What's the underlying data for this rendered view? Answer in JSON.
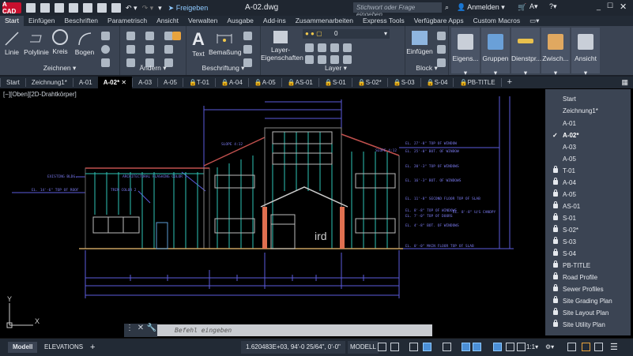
{
  "title_bar": {
    "logo": "A CAD",
    "share": "Freigeben",
    "filename": "A-02.dwg",
    "search_placeholder": "Stichwort oder Frage eingeben",
    "signin": "Anmelden"
  },
  "ribbon_tabs": [
    "Start",
    "Einfügen",
    "Beschriften",
    "Parametrisch",
    "Ansicht",
    "Verwalten",
    "Ausgabe",
    "Add-ins",
    "Zusammenarbeiten",
    "Express Tools",
    "Verfügbare Apps",
    "Custom Macros"
  ],
  "ribbon": {
    "zeichnen": {
      "title": "Zeichnen",
      "tools": [
        "Linie",
        "Polylinie",
        "Kreis",
        "Bogen"
      ]
    },
    "aendern": {
      "title": "Ändern"
    },
    "beschriftung": {
      "title": "Beschriftung",
      "tools": [
        "Text",
        "Bemaßung"
      ]
    },
    "layer": {
      "title": "Layer",
      "tool": "Layer-Eigenschaften",
      "current": "0"
    },
    "block": {
      "title": "Block",
      "tool": "Einfügen"
    },
    "extra": [
      "Eigens...",
      "Gruppen",
      "Dienstpr...",
      "Zwisch...",
      "Ansicht"
    ]
  },
  "file_tabs": [
    {
      "label": "Start",
      "lock": false
    },
    {
      "label": "Zeichnung1*",
      "lock": false
    },
    {
      "label": "A-01",
      "lock": false
    },
    {
      "label": "A-02*",
      "lock": false,
      "active": true
    },
    {
      "label": "A-03",
      "lock": false
    },
    {
      "label": "A-05",
      "lock": false
    },
    {
      "label": "T-01",
      "lock": true
    },
    {
      "label": "A-04",
      "lock": true
    },
    {
      "label": "A-05",
      "lock": true
    },
    {
      "label": "AS-01",
      "lock": true
    },
    {
      "label": "S-01",
      "lock": true
    },
    {
      "label": "S-02*",
      "lock": true
    },
    {
      "label": "S-03",
      "lock": true
    },
    {
      "label": "S-04",
      "lock": true
    },
    {
      "label": "PB-TITLE",
      "lock": true
    }
  ],
  "viewport_label": "[−][Oben][2D-Drahtkörper]",
  "drawing_menu": [
    {
      "label": "Start"
    },
    {
      "label": "Zeichnung1*"
    },
    {
      "label": "A-01"
    },
    {
      "label": "A-02*",
      "checked": true
    },
    {
      "label": "A-03"
    },
    {
      "label": "A-05"
    },
    {
      "label": "T-01",
      "lock": true
    },
    {
      "label": "A-04",
      "lock": true
    },
    {
      "label": "A-05",
      "lock": true
    },
    {
      "label": "AS-01",
      "lock": true
    },
    {
      "label": "S-01",
      "lock": true
    },
    {
      "label": "S-02*",
      "lock": true
    },
    {
      "label": "S-03",
      "lock": true
    },
    {
      "label": "S-04",
      "lock": true
    },
    {
      "label": "PB-TITLE",
      "lock": true
    },
    {
      "label": "Road Profile",
      "lock": true
    },
    {
      "label": "Sewer Profiles",
      "lock": true
    },
    {
      "label": "Site Grading Plan",
      "lock": true
    },
    {
      "label": "Site Layout Plan",
      "lock": true
    },
    {
      "label": "Site Utility Plan",
      "lock": true
    }
  ],
  "drawing_annotations": {
    "right": [
      "EL. 27'-0\" TOP OF WINDOW",
      "EL. 25'-0\" BOT. OF WINDOW",
      "EL. 20'-3\" TOP OF WINDOWS",
      "EL. 16'-3\" BOT. OF WINDOWS",
      "EL. 11'-8\" SECOND FLOOR TOP OF SLAB",
      "EL. 8'-8\" TOP OF WINDOWS",
      "EL. 7'-0\" TOP OF DOORS",
      "EL. 4'-8\" BOT. OF WINDOWS",
      "EL. 0'-0\" MAIN FLOOR TOP OF SLAB"
    ],
    "canopy": "EL. 8'-8\" U/S CANOPY",
    "existing": "EXISTING BLDG.",
    "roof": "EL. 14'-6\" TOP OF ROOF",
    "flashing": "ARCHITECTURAL FLASHING COLOR 1",
    "trim": "TRIM COLOR 2",
    "slope": "SLOPE 4:12",
    "watermark": "ird"
  },
  "ucs": {
    "x": "X",
    "y": "Y"
  },
  "command_placeholder": "Befehl eingeben",
  "status_bar": {
    "layout_tabs": [
      "Modell",
      "ELEVATIONS"
    ],
    "coordinates": "1.620483E+03, 94'-0 25/64\", 0'-0\"",
    "space": "MODELL",
    "scale": "1:1"
  }
}
